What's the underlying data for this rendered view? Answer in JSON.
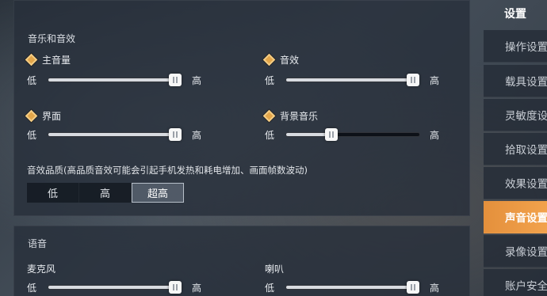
{
  "audio_section": {
    "title": "音乐和音效",
    "sliders": [
      {
        "label": "主音量",
        "min_label": "低",
        "max_label": "高",
        "value_pct": 100
      },
      {
        "label": "音效",
        "min_label": "低",
        "max_label": "高",
        "value_pct": 100
      },
      {
        "label": "界面",
        "min_label": "低",
        "max_label": "高",
        "value_pct": 100
      },
      {
        "label": "背景音乐",
        "min_label": "低",
        "max_label": "高",
        "value_pct": 34
      }
    ],
    "quality": {
      "title": "音效品质(高品质音效可能会引起手机发热和耗电增加、画面帧数波动)",
      "options": [
        "低",
        "高",
        "超高"
      ],
      "selected": "超高"
    }
  },
  "voice_section": {
    "title": "语音",
    "sliders": [
      {
        "label": "麦克风",
        "min_label": "低",
        "max_label": "高",
        "value_pct": 100
      },
      {
        "label": "喇叭",
        "min_label": "低",
        "max_label": "高",
        "value_pct": 100
      }
    ]
  },
  "sidebar": {
    "header": "设置",
    "items": [
      {
        "label": "操作设置",
        "active": false
      },
      {
        "label": "载具设置",
        "active": false
      },
      {
        "label": "灵敏度设置",
        "active": false
      },
      {
        "label": "拾取设置",
        "active": false
      },
      {
        "label": "效果设置",
        "active": false
      },
      {
        "label": "声音设置",
        "active": true
      },
      {
        "label": "录像设置",
        "active": false
      },
      {
        "label": "账户安全",
        "active": false
      }
    ]
  },
  "colors": {
    "accent": "#f2a24c",
    "diamond_icon": "#e3a64a"
  }
}
